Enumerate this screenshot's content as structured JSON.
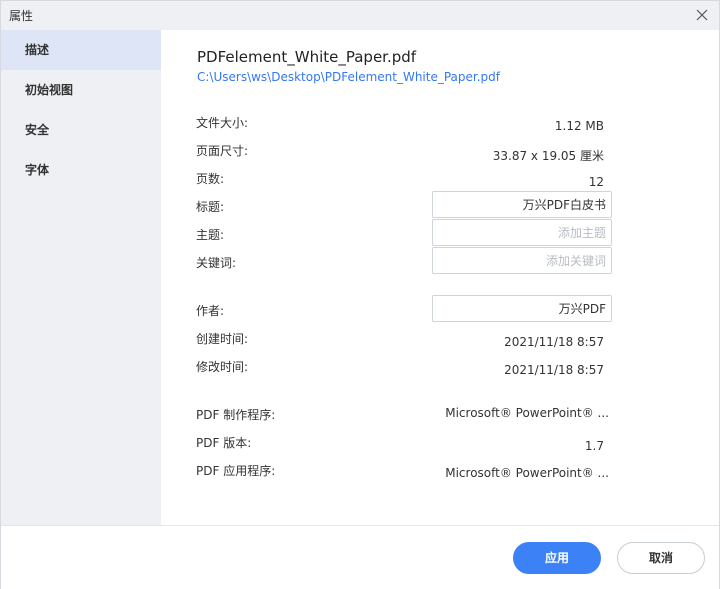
{
  "window": {
    "title": "属性"
  },
  "sidebar": {
    "items": [
      {
        "label": "描述",
        "active": true
      },
      {
        "label": "初始视图",
        "active": false
      },
      {
        "label": "安全",
        "active": false
      },
      {
        "label": "字体",
        "active": false
      }
    ]
  },
  "file": {
    "name": "PDFelement_White_Paper.pdf",
    "path": "C:\\Users\\ws\\Desktop\\PDFelement_White_Paper.pdf"
  },
  "properties": {
    "file_size": {
      "label": "文件大小:",
      "value": "1.12 MB"
    },
    "page_size": {
      "label": "页面尺寸:",
      "value": "33.87 x 19.05 厘米"
    },
    "page_count": {
      "label": "页数:",
      "value": "12"
    },
    "title": {
      "label": "标题:",
      "value": "万兴PDF白皮书",
      "placeholder": ""
    },
    "subject": {
      "label": "主题:",
      "value": "",
      "placeholder": "添加主题"
    },
    "keywords": {
      "label": "关键词:",
      "value": "",
      "placeholder": "添加关键词"
    },
    "author": {
      "label": "作者:",
      "value": "万兴PDF",
      "placeholder": ""
    },
    "created": {
      "label": "创建时间:",
      "value": "2021/11/18 8:57"
    },
    "modified": {
      "label": "修改时间:",
      "value": "2021/11/18 8:57"
    },
    "creator": {
      "label": "PDF 制作程序:",
      "value": "Microsoft® PowerPoint® ..."
    },
    "version": {
      "label": "PDF 版本:",
      "value": "1.7"
    },
    "producer": {
      "label": "PDF 应用程序:",
      "value": "Microsoft® PowerPoint® ..."
    }
  },
  "footer": {
    "apply_label": "应用",
    "cancel_label": "取消"
  },
  "colors": {
    "accent": "#3c82f6",
    "link": "#3478f6",
    "sidebar_bg": "#eef0f4",
    "sidebar_active_bg": "#dde5f6"
  },
  "icons": {
    "close": "close-icon"
  }
}
